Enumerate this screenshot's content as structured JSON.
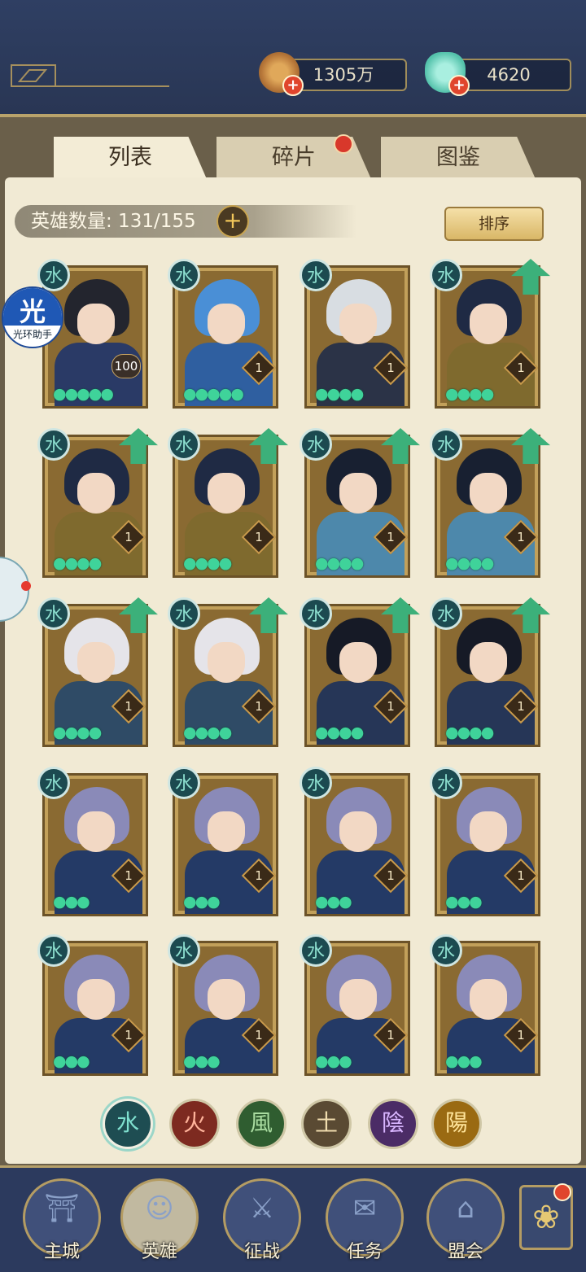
{
  "resources": {
    "copper": {
      "value": "1305万",
      "icon": "copper-coin-icon"
    },
    "jade": {
      "value": "4620",
      "icon": "jade-pouch-icon"
    }
  },
  "tabs": [
    {
      "label": "列表",
      "active": true
    },
    {
      "label": "碎片",
      "active": false,
      "has_dot": true
    },
    {
      "label": "图鉴",
      "active": false
    }
  ],
  "hero_count": {
    "label": "英雄数量: 131/155"
  },
  "sort_button": {
    "label": "排序"
  },
  "overlay_app": {
    "glyph": "光",
    "label": "光环助手"
  },
  "heroes": [
    {
      "level": "100",
      "stars": 5,
      "upgrade": false,
      "hair": "#23252e",
      "outfit": "#2a3a66"
    },
    {
      "level": "1",
      "stars": 5,
      "upgrade": false,
      "hair": "#4a8fd6",
      "outfit": "#2f5fa0"
    },
    {
      "level": "1",
      "stars": 4,
      "upgrade": false,
      "hair": "#d8dde2",
      "outfit": "#2b3347"
    },
    {
      "level": "1",
      "stars": 4,
      "upgrade": true,
      "hair": "#1f2a44",
      "outfit": "#7f6a2e"
    },
    {
      "level": "1",
      "stars": 4,
      "upgrade": true,
      "hair": "#1f2a44",
      "outfit": "#7f6a2e"
    },
    {
      "level": "1",
      "stars": 4,
      "upgrade": true,
      "hair": "#1f2a44",
      "outfit": "#7f6a2e"
    },
    {
      "level": "1",
      "stars": 4,
      "upgrade": true,
      "hair": "#182031",
      "outfit": "#4d88ab"
    },
    {
      "level": "1",
      "stars": 4,
      "upgrade": true,
      "hair": "#182031",
      "outfit": "#4d88ab"
    },
    {
      "level": "1",
      "stars": 4,
      "upgrade": true,
      "hair": "#e5e4e9",
      "outfit": "#2f4b66"
    },
    {
      "level": "1",
      "stars": 4,
      "upgrade": true,
      "hair": "#e5e4e9",
      "outfit": "#2f4b66"
    },
    {
      "level": "1",
      "stars": 4,
      "upgrade": true,
      "hair": "#161a26",
      "outfit": "#263657"
    },
    {
      "level": "1",
      "stars": 4,
      "upgrade": true,
      "hair": "#161a26",
      "outfit": "#263657"
    },
    {
      "level": "1",
      "stars": 3,
      "upgrade": false,
      "hair": "#8a8ab8",
      "outfit": "#243a66"
    },
    {
      "level": "1",
      "stars": 3,
      "upgrade": false,
      "hair": "#8a8ab8",
      "outfit": "#243a66"
    },
    {
      "level": "1",
      "stars": 3,
      "upgrade": false,
      "hair": "#8a8ab8",
      "outfit": "#243a66"
    },
    {
      "level": "1",
      "stars": 3,
      "upgrade": false,
      "hair": "#8a8ab8",
      "outfit": "#243a66"
    },
    {
      "level": "1",
      "stars": 3,
      "upgrade": false,
      "hair": "#8a8ab8",
      "outfit": "#243a66"
    },
    {
      "level": "1",
      "stars": 3,
      "upgrade": false,
      "hair": "#8a8ab8",
      "outfit": "#243a66"
    },
    {
      "level": "1",
      "stars": 3,
      "upgrade": false,
      "hair": "#8a8ab8",
      "outfit": "#243a66"
    },
    {
      "level": "1",
      "stars": 3,
      "upgrade": false,
      "hair": "#8a8ab8",
      "outfit": "#243a66"
    }
  ],
  "element_badge_glyph": "水",
  "filters": [
    {
      "glyph": "水",
      "name": "water-filter",
      "bg": "#1e4d52",
      "color": "#7fe0cf",
      "selected": true
    },
    {
      "glyph": "火",
      "name": "fire-filter",
      "bg": "#7d2a20",
      "color": "#ffb39a"
    },
    {
      "glyph": "風",
      "name": "wind-filter",
      "bg": "#2f5d30",
      "color": "#a9dca0"
    },
    {
      "glyph": "土",
      "name": "earth-filter",
      "bg": "#5a4a33",
      "color": "#f0dcae"
    },
    {
      "glyph": "陰",
      "name": "yin-filter",
      "bg": "#4b2c66",
      "color": "#d9b6ff"
    },
    {
      "glyph": "陽",
      "name": "yang-filter",
      "bg": "#9a6a12",
      "color": "#ffe49a"
    }
  ],
  "nav": [
    {
      "label": "主城",
      "icon": "city-gate-icon",
      "glyph": "⛩"
    },
    {
      "label": "英雄",
      "icon": "hero-portrait-icon",
      "glyph": "☺",
      "active": true
    },
    {
      "label": "征战",
      "icon": "battle-horn-icon",
      "glyph": "⚔"
    },
    {
      "label": "任务",
      "icon": "quest-scroll-icon",
      "glyph": "✉"
    },
    {
      "label": "盟会",
      "icon": "alliance-pavilion-icon",
      "glyph": "⌂"
    }
  ],
  "side_menu": {
    "icon": "flower-menu-icon",
    "glyph": "❀",
    "has_dot": true
  }
}
